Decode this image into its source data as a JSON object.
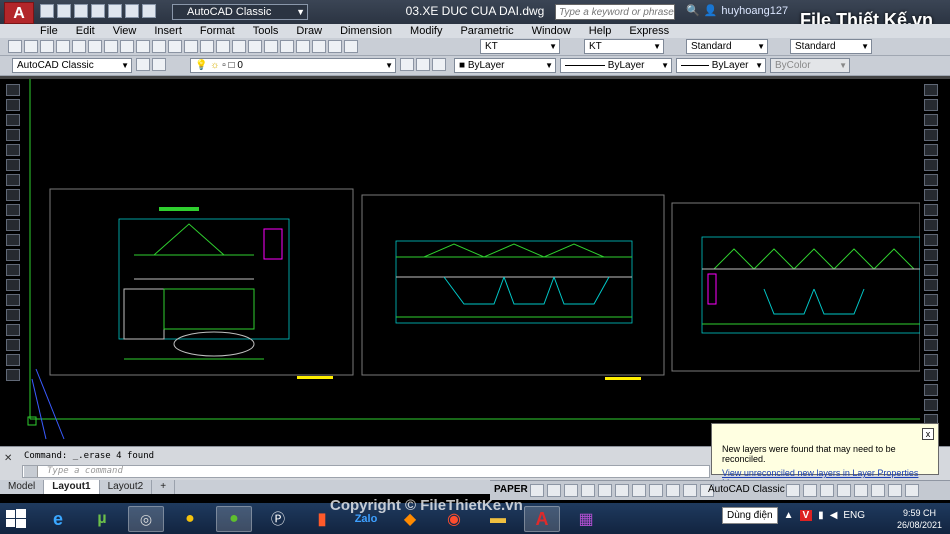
{
  "titlebar": {
    "app_letter": "A",
    "workspace": "AutoCAD Classic",
    "document_title": "03.XE DUC CUA DAI.dwg",
    "search_placeholder": "Type a keyword or phrase",
    "username": "huyhoang127"
  },
  "menu": [
    "File",
    "Edit",
    "View",
    "Insert",
    "Format",
    "Tools",
    "Draw",
    "Dimension",
    "Modify",
    "Parametric",
    "Window",
    "Help",
    "Express"
  ],
  "toolbar1": {
    "text_style": "KT",
    "dim_style": "KT",
    "table_style": "Standard",
    "mleader_style": "Standard"
  },
  "toolbar2": {
    "workspace": "AutoCAD Classic",
    "layer": "0",
    "color": "ByLayer",
    "linetype": "ByLayer",
    "lineweight": "ByLayer",
    "plotstyle": "ByColor"
  },
  "command": {
    "history": "Command: _.erase 4 found",
    "placeholder": "Type a command"
  },
  "layout_tabs": [
    "Model",
    "Layout1",
    "Layout2"
  ],
  "layout_add": "+",
  "status": {
    "space": "PAPER",
    "workspace": "AutoCAD Classic"
  },
  "balloon": {
    "message": "New layers were found that may need to be reconciled.",
    "link": "View unreconciled new layers in Layer Properties Manager",
    "close": "x"
  },
  "taskbar": {
    "power_label": "Dùng điện",
    "lang": "ENG",
    "time": "9:59 CH",
    "date": "26/08/2021"
  },
  "logo_text": "File Thiết Kế.vn",
  "watermark": "Copyright © FileThietKe.vn"
}
